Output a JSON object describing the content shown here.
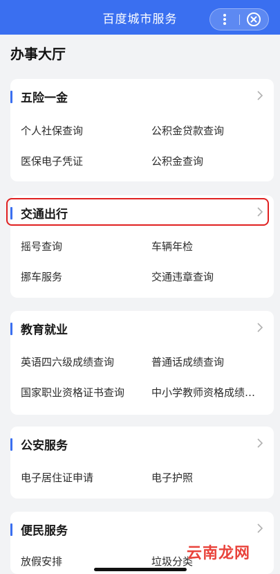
{
  "header": {
    "title": "百度城市服务",
    "more_icon": "more-vertical-icon",
    "close_icon": "close-circle-icon",
    "accent": "#3a6ff0"
  },
  "page": {
    "title": "办事大厅"
  },
  "sections": [
    {
      "title": "五险一金",
      "items": [
        "个人社保查询",
        "公积金贷款查询",
        "医保电子凭证",
        "公积金查询"
      ]
    },
    {
      "title": "交通出行",
      "items": [
        "摇号查询",
        "车辆年检",
        "挪车服务",
        "交通违章查询"
      ]
    },
    {
      "title": "教育就业",
      "items": [
        "英语四六级成绩查询",
        "普通话成绩查询",
        "国家职业资格证书查询",
        "中小学教师资格成绩查询"
      ]
    },
    {
      "title": "公安服务",
      "items": [
        "电子居住证申请",
        "电子护照"
      ]
    },
    {
      "title": "便民服务",
      "items": [
        "放假安排",
        "垃圾分类"
      ]
    }
  ],
  "highlight_color": "#e02020",
  "watermark": "云南龙网"
}
